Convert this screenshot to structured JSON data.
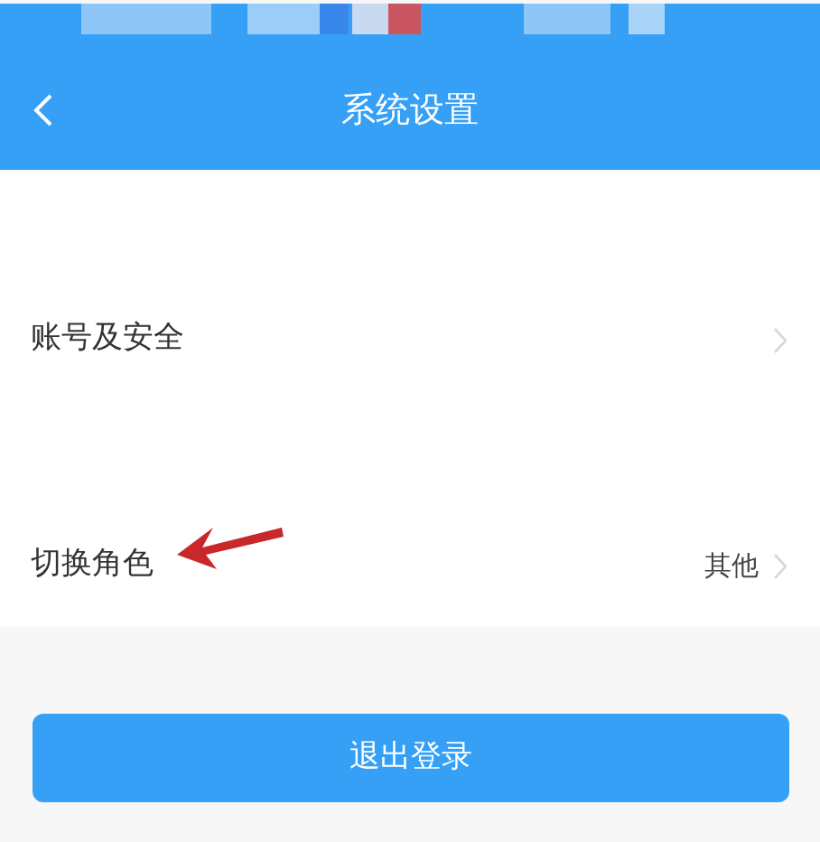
{
  "header": {
    "title": "系统设置"
  },
  "settings": [
    {
      "label": "账号及安全"
    },
    {
      "label": "切换角色",
      "value": "其他"
    }
  ],
  "logout_button": "退出登录"
}
